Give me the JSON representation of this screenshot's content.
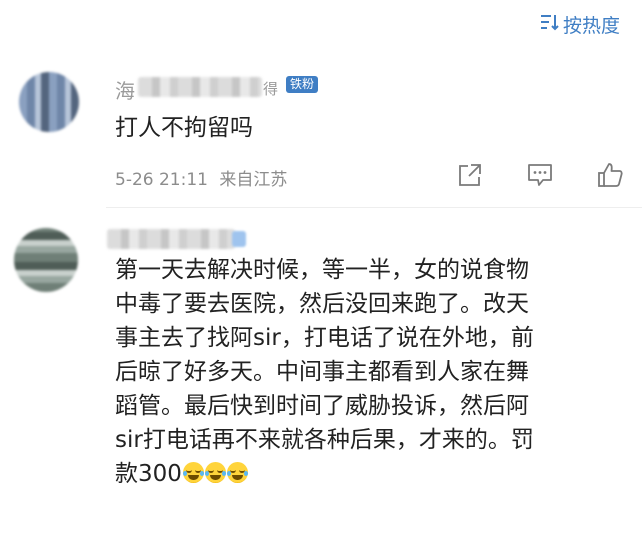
{
  "sort": {
    "label": "按热度",
    "icon": "sort-icon"
  },
  "comments": [
    {
      "username_visible": "海",
      "username_tail": "得",
      "badge": "铁粉",
      "text": "打人不拘留吗",
      "time": "5-26 21:11",
      "location": "来自江苏",
      "actions": [
        "share-icon",
        "comment-icon",
        "like-icon"
      ]
    },
    {
      "text_lines": [
        "第一天去解决时候，等一半，女的说食物",
        "中毒了要去医院，然后没回来跑了。改天",
        "事主去了找阿sir，打电话了说在外地，前",
        "后晾了好多天。中间事主都看到人家在舞",
        "蹈管。最后快到时间了威胁投诉，然后阿",
        "sir打电话再不来就各种后果，才来的。罚"
      ],
      "last_line_prefix": "款300",
      "emoji_count": 3,
      "emoji_name": "laugh-cry-emoji"
    }
  ]
}
